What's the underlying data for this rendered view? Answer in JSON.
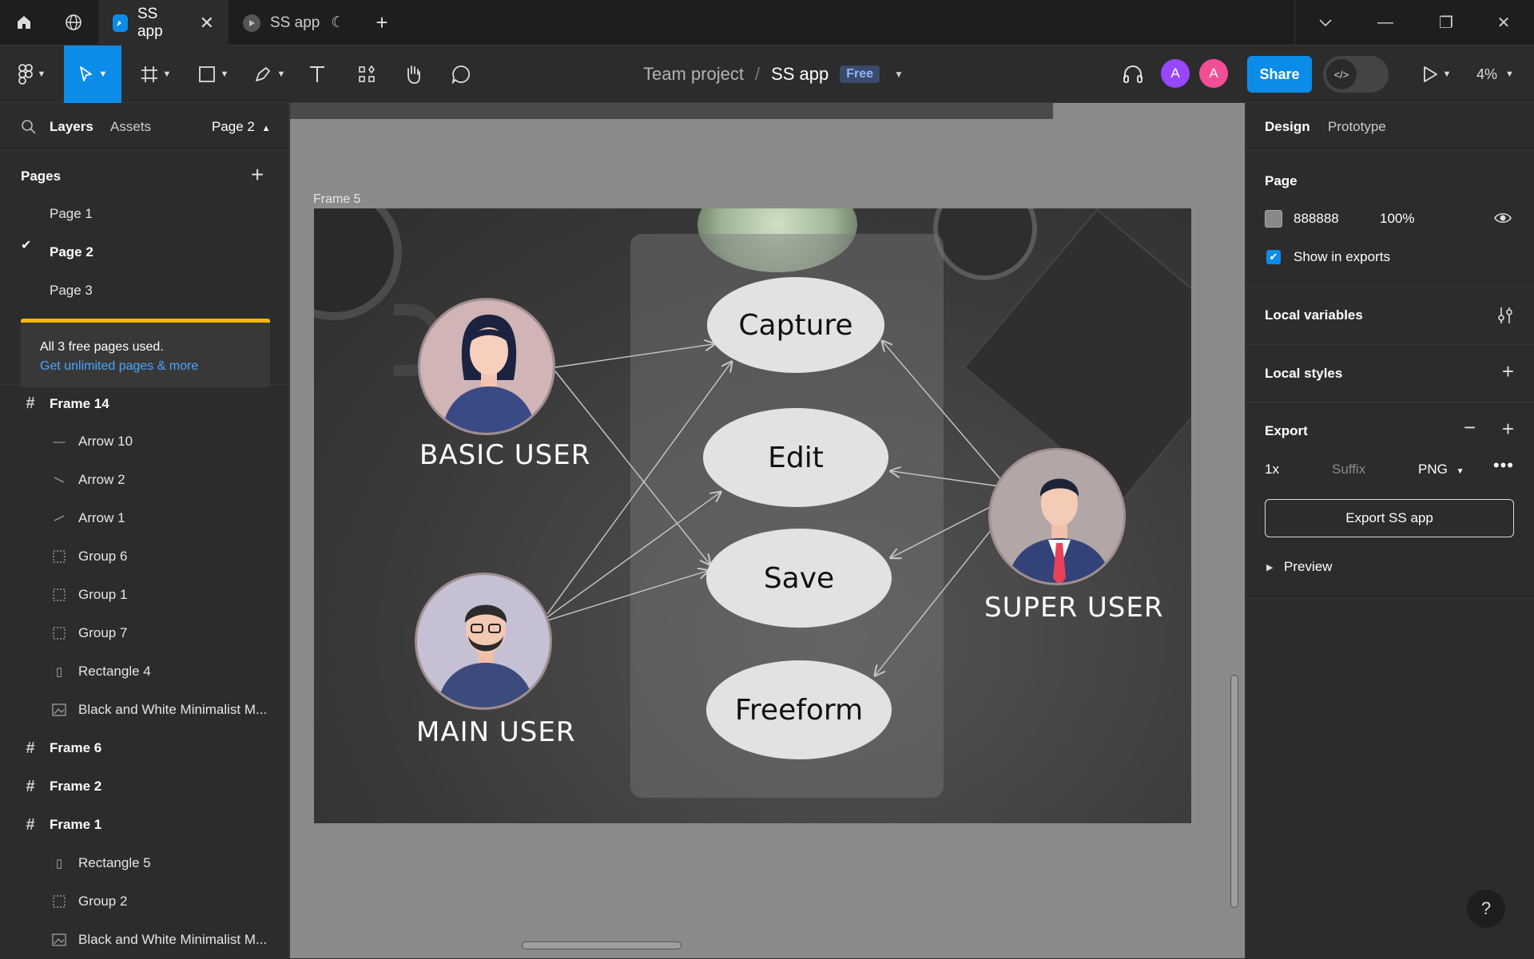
{
  "tabs": [
    {
      "label": "SS app",
      "active": true
    },
    {
      "label": "SS app",
      "active": false
    }
  ],
  "toolbar": {
    "team": "Team project",
    "separator": "/",
    "file": "SS app",
    "plan_badge": "Free",
    "avatar_1": "A",
    "avatar_2": "A",
    "share": "Share",
    "zoom": "4%"
  },
  "left_panel": {
    "tab_layers": "Layers",
    "tab_assets": "Assets",
    "current_page": "Page 2",
    "pages_title": "Pages",
    "pages": [
      "Page 1",
      "Page 2",
      "Page 3"
    ],
    "limit_text": "All 3 free pages used.",
    "limit_link": "Get unlimited pages & more",
    "layers": [
      {
        "name": "Frame 14",
        "kind": "frame"
      },
      {
        "name": "Arrow 10",
        "kind": "line"
      },
      {
        "name": "Arrow 2",
        "kind": "line"
      },
      {
        "name": "Arrow 1",
        "kind": "line"
      },
      {
        "name": "Group 6",
        "kind": "group"
      },
      {
        "name": "Group 1",
        "kind": "group"
      },
      {
        "name": "Group 7",
        "kind": "group"
      },
      {
        "name": "Rectangle 4",
        "kind": "rect"
      },
      {
        "name": "Black and White Minimalist M...",
        "kind": "image"
      },
      {
        "name": "Frame 6",
        "kind": "frame"
      },
      {
        "name": "Frame 2",
        "kind": "frame"
      },
      {
        "name": "Frame 1",
        "kind": "frame"
      },
      {
        "name": "Rectangle 5",
        "kind": "rect"
      },
      {
        "name": "Group 2",
        "kind": "group"
      },
      {
        "name": "Black and White Minimalist M...",
        "kind": "image"
      }
    ]
  },
  "canvas": {
    "frame_label": "Frame 5",
    "use_cases": [
      "Capture",
      "Edit",
      "Save",
      "Freeform"
    ],
    "actors": [
      "BASIC USER",
      "MAIN USER",
      "SUPER USER"
    ]
  },
  "right_panel": {
    "tab_design": "Design",
    "tab_prototype": "Prototype",
    "page_title": "Page",
    "page_color": "888888",
    "page_opacity": "100%",
    "show_in_exports": "Show in exports",
    "local_variables": "Local variables",
    "local_styles": "Local styles",
    "export_title": "Export",
    "export_scale": "1x",
    "export_suffix_placeholder": "Suffix",
    "export_format": "PNG",
    "export_button": "Export SS app",
    "preview": "Preview"
  },
  "colors": {
    "accent": "#0c8ce9",
    "avatar_1": "#9747ff",
    "avatar_2": "#f24e96",
    "warning_bar": "#f5b800",
    "canvas_bg": "#888888"
  }
}
